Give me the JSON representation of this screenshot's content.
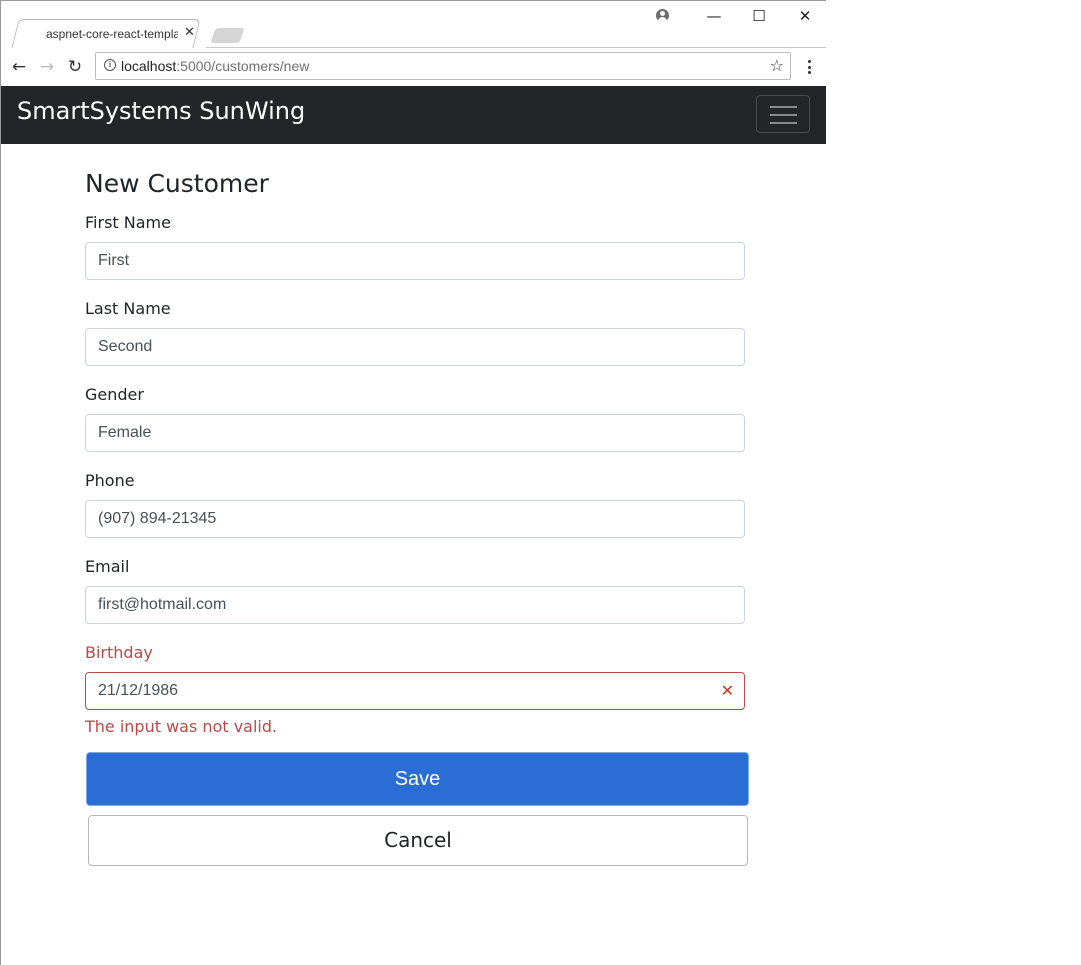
{
  "browser": {
    "tab": {
      "title": "aspnet-core-react-template",
      "close_glyph": "✕"
    },
    "window_controls": {
      "minimize": "—",
      "maximize": "☐",
      "close": "✕"
    },
    "toolbar": {
      "back_glyph": "←",
      "forward_glyph": "→",
      "reload_glyph": "↻",
      "info_glyph": "i",
      "url_host": "localhost",
      "url_path": ":5000/customers/new",
      "star_glyph": "☆"
    }
  },
  "navbar": {
    "brand": "SmartSystems SunWing"
  },
  "form": {
    "title": "New Customer",
    "first_name": {
      "label": "First Name",
      "value": "First"
    },
    "last_name": {
      "label": "Last Name",
      "value": "Second"
    },
    "gender": {
      "label": "Gender",
      "value": "Female"
    },
    "phone": {
      "label": "Phone",
      "value": "(907) 894-21345"
    },
    "email": {
      "label": "Email",
      "value": "first@hotmail.com"
    },
    "birthday": {
      "label": "Birthday",
      "value": "21/12/1986",
      "clear_glyph": "✕",
      "error": "The input was not valid."
    },
    "save_label": "Save",
    "cancel_label": "Cancel"
  },
  "colors": {
    "navbar_bg": "#242526",
    "primary": "#2a6ed5",
    "error": "#b94a48"
  },
  "icons": [
    "profile-icon",
    "back-arrow-icon",
    "forward-arrow-icon",
    "reload-icon",
    "info-icon",
    "star-icon",
    "menu-icon",
    "hamburger-icon",
    "close-icon"
  ]
}
